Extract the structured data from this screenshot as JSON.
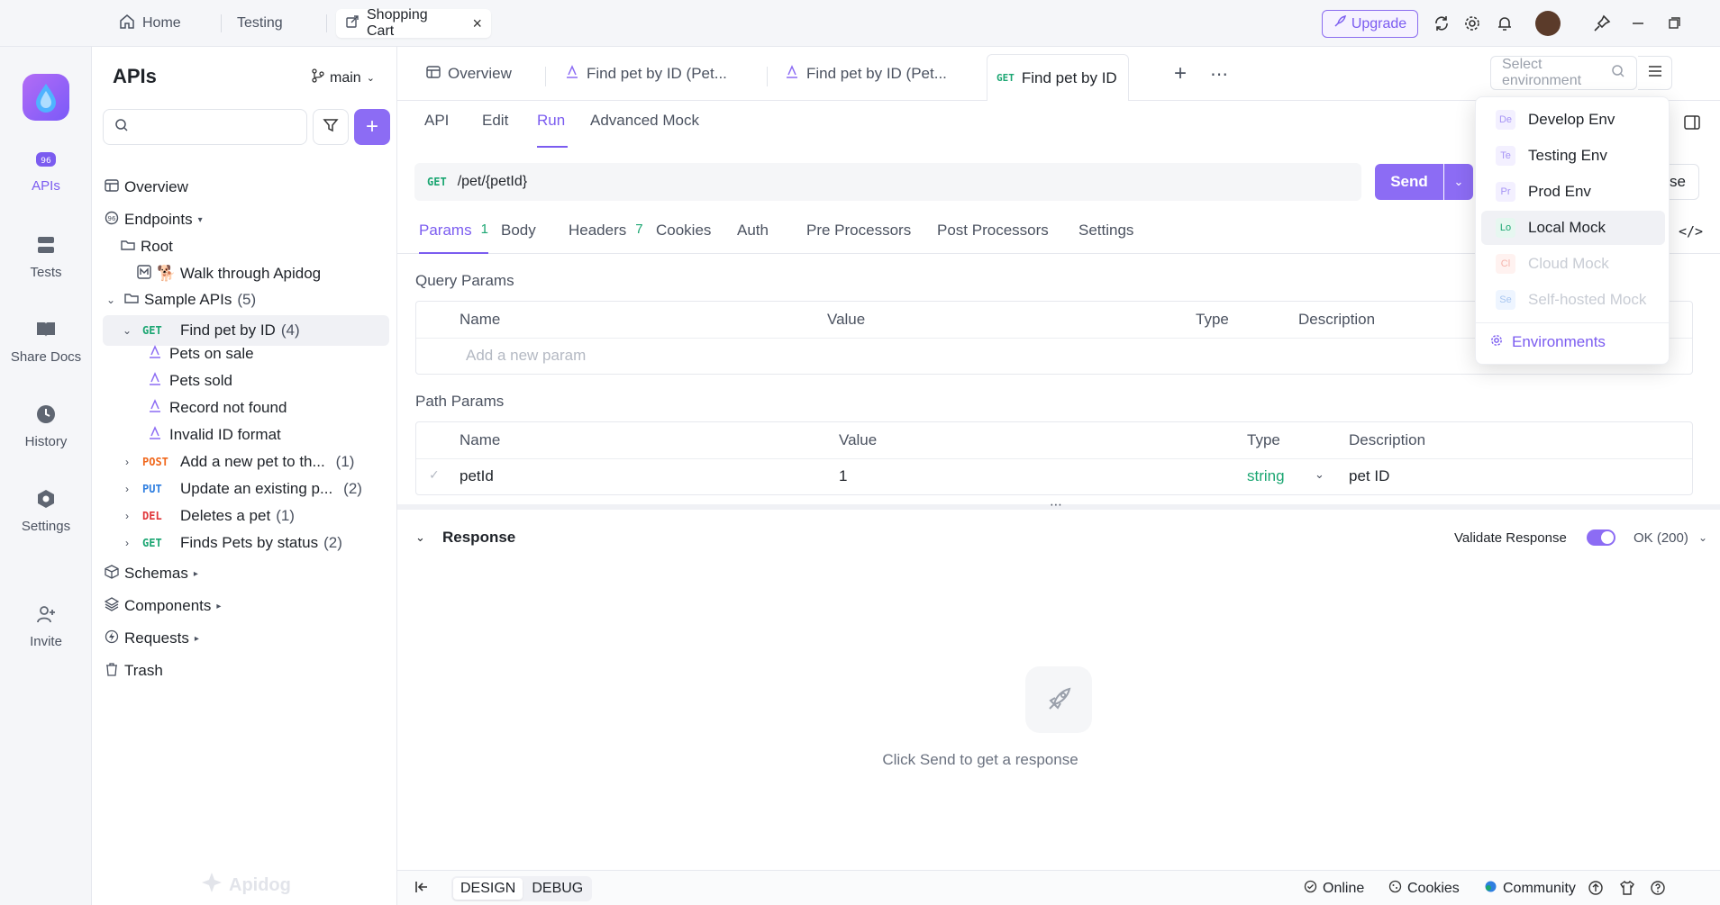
{
  "topbar": {
    "tabs": [
      {
        "label": "Home",
        "icon": "home-icon"
      },
      {
        "label": "Testing"
      },
      {
        "label": "Shopping Cart",
        "icon": "external-icon",
        "active": true
      }
    ],
    "upgrade_label": "Upgrade"
  },
  "leftnav": {
    "items": [
      {
        "label": "APIs",
        "icon": "apis-icon",
        "active": true
      },
      {
        "label": "Tests",
        "icon": "tests-icon"
      },
      {
        "label": "Share Docs",
        "icon": "book-icon"
      },
      {
        "label": "History",
        "icon": "clock-icon"
      },
      {
        "label": "Settings",
        "icon": "settings-icon"
      },
      {
        "label": "Invite",
        "icon": "invite-icon"
      }
    ]
  },
  "sidebar": {
    "title": "APIs",
    "branch": "main",
    "search_placeholder": "",
    "tree": {
      "overview": "Overview",
      "endpoints": "Endpoints",
      "root": "Root",
      "walk": "🐕 Walk through Apidog",
      "sample_apis": "Sample APIs",
      "sample_count": "(5)",
      "find_pet": {
        "method": "GET",
        "label": "Find pet by ID",
        "count": "(4)"
      },
      "cases": [
        "Pets on sale",
        "Pets sold",
        "Record not found",
        "Invalid ID format"
      ],
      "endpoints_list": [
        {
          "method": "POST",
          "label": "Add a new pet to th...",
          "count": "(1)"
        },
        {
          "method": "PUT",
          "label": "Update an existing p...",
          "count": "(2)"
        },
        {
          "method": "DEL",
          "label": "Deletes a pet",
          "count": "(1)"
        },
        {
          "method": "GET",
          "label": "Finds Pets by status",
          "count": "(2)"
        }
      ],
      "schemas": "Schemas",
      "components": "Components",
      "requests": "Requests",
      "trash": "Trash"
    },
    "watermark": "Apidog"
  },
  "main": {
    "doc_tabs": [
      {
        "label": "Overview"
      },
      {
        "label": "Find pet by ID (Pet..."
      },
      {
        "label": "Find pet by ID (Pet..."
      },
      {
        "method": "GET",
        "label": "Find pet by ID",
        "active": true
      }
    ],
    "env_placeholder": "Select environment",
    "subtabs": [
      "API",
      "Edit",
      "Run",
      "Advanced Mock"
    ],
    "active_subtab": "Run",
    "url": {
      "method": "GET",
      "path": "/pet/{petId}"
    },
    "send_label": "Send",
    "save_label_partial": "se",
    "param_tabs": [
      {
        "label": "Params",
        "badge": "1"
      },
      {
        "label": "Body"
      },
      {
        "label": "Headers",
        "badge": "7"
      },
      {
        "label": "Cookies"
      },
      {
        "label": "Auth"
      },
      {
        "label": "Pre Processors"
      },
      {
        "label": "Post Processors"
      },
      {
        "label": "Settings"
      }
    ],
    "query_params": {
      "title": "Query Params",
      "headers": [
        "Name",
        "Value",
        "Type",
        "Description"
      ],
      "add_placeholder": "Add a new param"
    },
    "path_params": {
      "title": "Path Params",
      "headers": [
        "Name",
        "Value",
        "Type",
        "Description"
      ],
      "rows": [
        {
          "name": "petId",
          "value": "1",
          "type": "string",
          "description": "pet ID"
        }
      ]
    },
    "response": {
      "title": "Response",
      "validate_label": "Validate Response",
      "status_option": "OK (200)",
      "empty_text": "Click Send to get a response"
    },
    "statusbar": {
      "design": "DESIGN",
      "debug": "DEBUG",
      "online": "Online",
      "cookies": "Cookies",
      "community": "Community"
    }
  },
  "env_menu": {
    "items": [
      {
        "abbr": "De",
        "label": "Develop Env",
        "enabled": true
      },
      {
        "abbr": "Te",
        "label": "Testing Env",
        "enabled": true
      },
      {
        "abbr": "Pr",
        "label": "Prod Env",
        "enabled": true
      },
      {
        "abbr": "Lo",
        "label": "Local Mock",
        "enabled": true,
        "hover": true
      },
      {
        "abbr": "Cl",
        "label": "Cloud Mock",
        "enabled": false
      },
      {
        "abbr": "Se",
        "label": "Self-hosted Mock",
        "enabled": false
      }
    ],
    "link": "Environments"
  },
  "colors": {
    "accent": "#7b5cf0",
    "get": "#1ba672",
    "post": "#f0681d",
    "put": "#2f7fe0",
    "del": "#e0363a"
  }
}
